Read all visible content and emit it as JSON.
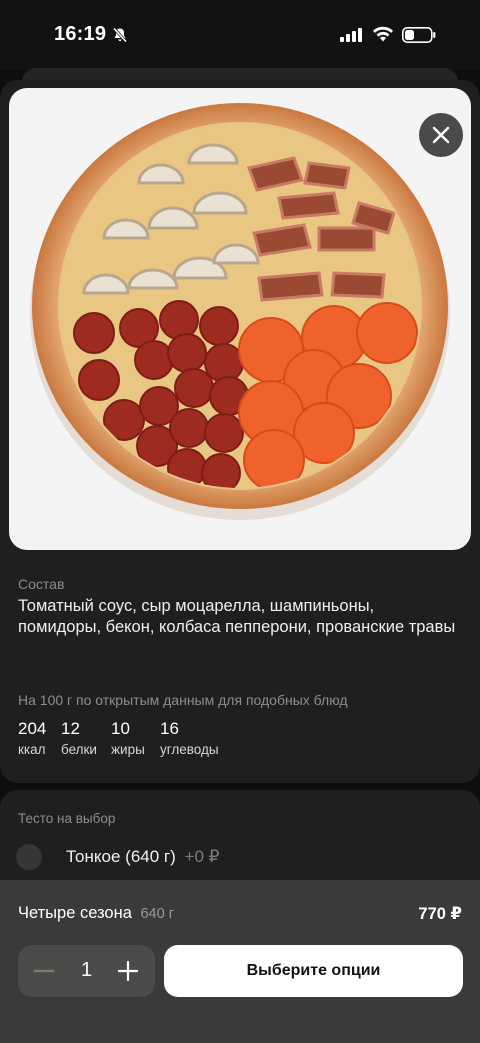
{
  "status_bar": {
    "time": "16:19"
  },
  "product": {
    "composition_title": "Состав",
    "composition": "Томатный соус, сыр моцарелла, шампиньоны, помидоры, бекон, колбаса пепперони, прованские травы",
    "nutrition_note": "На 100 г по открытым данным для подобных блюд",
    "nutrition": [
      {
        "value": "204",
        "label": "ккал"
      },
      {
        "value": "12",
        "label": "белки"
      },
      {
        "value": "10",
        "label": "жиры"
      },
      {
        "value": "16",
        "label": "углеводы"
      }
    ]
  },
  "options": {
    "title": "Тесто на выбор",
    "items": [
      {
        "label": "Тонкое (640 г)",
        "price": "+0 ₽"
      }
    ]
  },
  "bottom_bar": {
    "name": "Четыре сезона",
    "weight": "640 г",
    "price": "770 ₽",
    "quantity": "1",
    "cta": "Выберите опции"
  },
  "icons": [
    "bell-slash-icon",
    "signal-icon",
    "wifi-icon",
    "battery-icon",
    "close-icon",
    "minus-icon",
    "plus-icon"
  ]
}
